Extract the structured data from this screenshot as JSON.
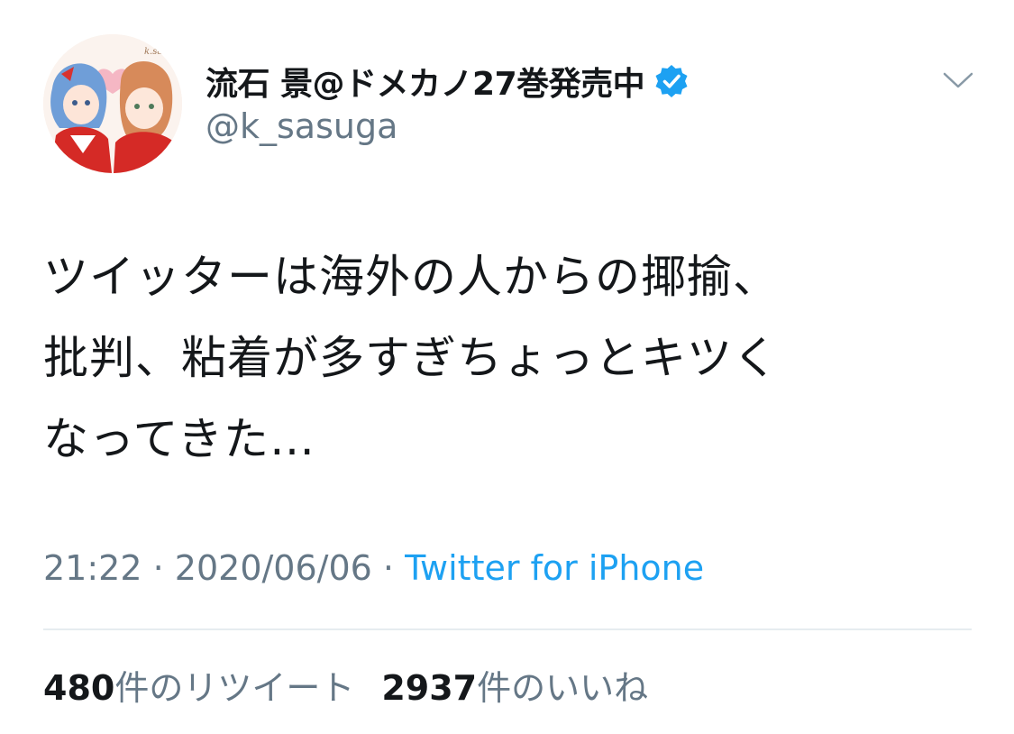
{
  "user": {
    "display_name": "流石 景@ドメカノ27巻発売中",
    "handle": "@k_sasuga",
    "verified": true,
    "avatar_signature": "k.sasuga"
  },
  "tweet": {
    "lines": [
      "ツイッターは海外の人からの揶揄、",
      "批判、粘着が多すぎちょっとキツく",
      "なってきた…"
    ],
    "time": "21:22",
    "separator": "·",
    "date": "2020/06/06",
    "source": "Twitter for iPhone"
  },
  "stats": {
    "retweets_count": "480",
    "retweets_label": "件のリツイート",
    "likes_count": "2937",
    "likes_label": "件のいいね"
  },
  "icons": {
    "verified": "verified-badge-icon",
    "menu": "chevron-down-icon"
  },
  "colors": {
    "text": "#14171a",
    "secondary": "#657786",
    "accent": "#1da1f2",
    "divider": "#e6ecf0"
  }
}
